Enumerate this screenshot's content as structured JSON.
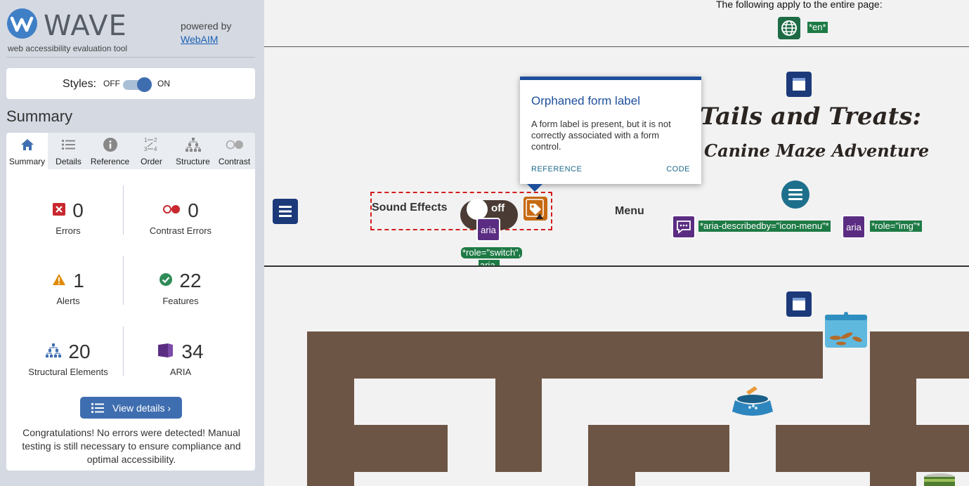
{
  "wave": {
    "logo_word": "WAVE",
    "logo_sub": "web accessibility evaluation tool",
    "powered_by": "powered by",
    "powered_link": "WebAIM",
    "styles_label": "Styles:",
    "styles_off": "OFF",
    "styles_on": "ON",
    "styles_state": "on",
    "summary_heading": "Summary",
    "tabs": [
      {
        "label": "Summary",
        "icon": "home-icon",
        "active": true
      },
      {
        "label": "Details",
        "icon": "list-icon",
        "active": false
      },
      {
        "label": "Reference",
        "icon": "info-icon",
        "active": false
      },
      {
        "label": "Order",
        "icon": "order-icon",
        "active": false
      },
      {
        "label": "Structure",
        "icon": "structure-icon",
        "active": false
      },
      {
        "label": "Contrast",
        "icon": "contrast-icon",
        "active": false
      }
    ],
    "stats": {
      "errors": {
        "count": "0",
        "label": "Errors"
      },
      "contrast_errors": {
        "count": "0",
        "label": "Contrast Errors"
      },
      "alerts": {
        "count": "1",
        "label": "Alerts"
      },
      "features": {
        "count": "22",
        "label": "Features"
      },
      "structural": {
        "count": "20",
        "label": "Structural Elements"
      },
      "aria": {
        "count": "34",
        "label": "ARIA"
      }
    },
    "view_details": "View details ›",
    "congrats": "Congratulations! No errors were detected! Manual testing is still necessary to ensure compliance and optimal accessibility."
  },
  "page": {
    "top_note": "The following apply to the entire page:",
    "lang_tag": "*en*",
    "title_line1": "Tails and Treats:",
    "title_line2": "Canine Maze Adventure",
    "sound_label": "Sound Effects",
    "switch_text": "off",
    "aria_badge": "aria",
    "switch_tag": "*role=\"switch\",",
    "switch_tag2": "aria-",
    "menu_label": "Menu",
    "describedby_tag": "*aria-describedby=\"icon-menu\"*",
    "role_img_tag": "*role=\"img\"*"
  },
  "tooltip": {
    "title": "Orphaned form label",
    "body": "A form label is present, but it is not correctly associated with a form control.",
    "reference": "REFERENCE",
    "code": "CODE"
  },
  "colors": {
    "wave_blue": "#3f6eb0",
    "error_red": "#c8282e",
    "alert_orange": "#e08a00",
    "feature_green": "#1e7a45",
    "aria_purple": "#5b2d82",
    "maze_brown": "#6d5545"
  }
}
